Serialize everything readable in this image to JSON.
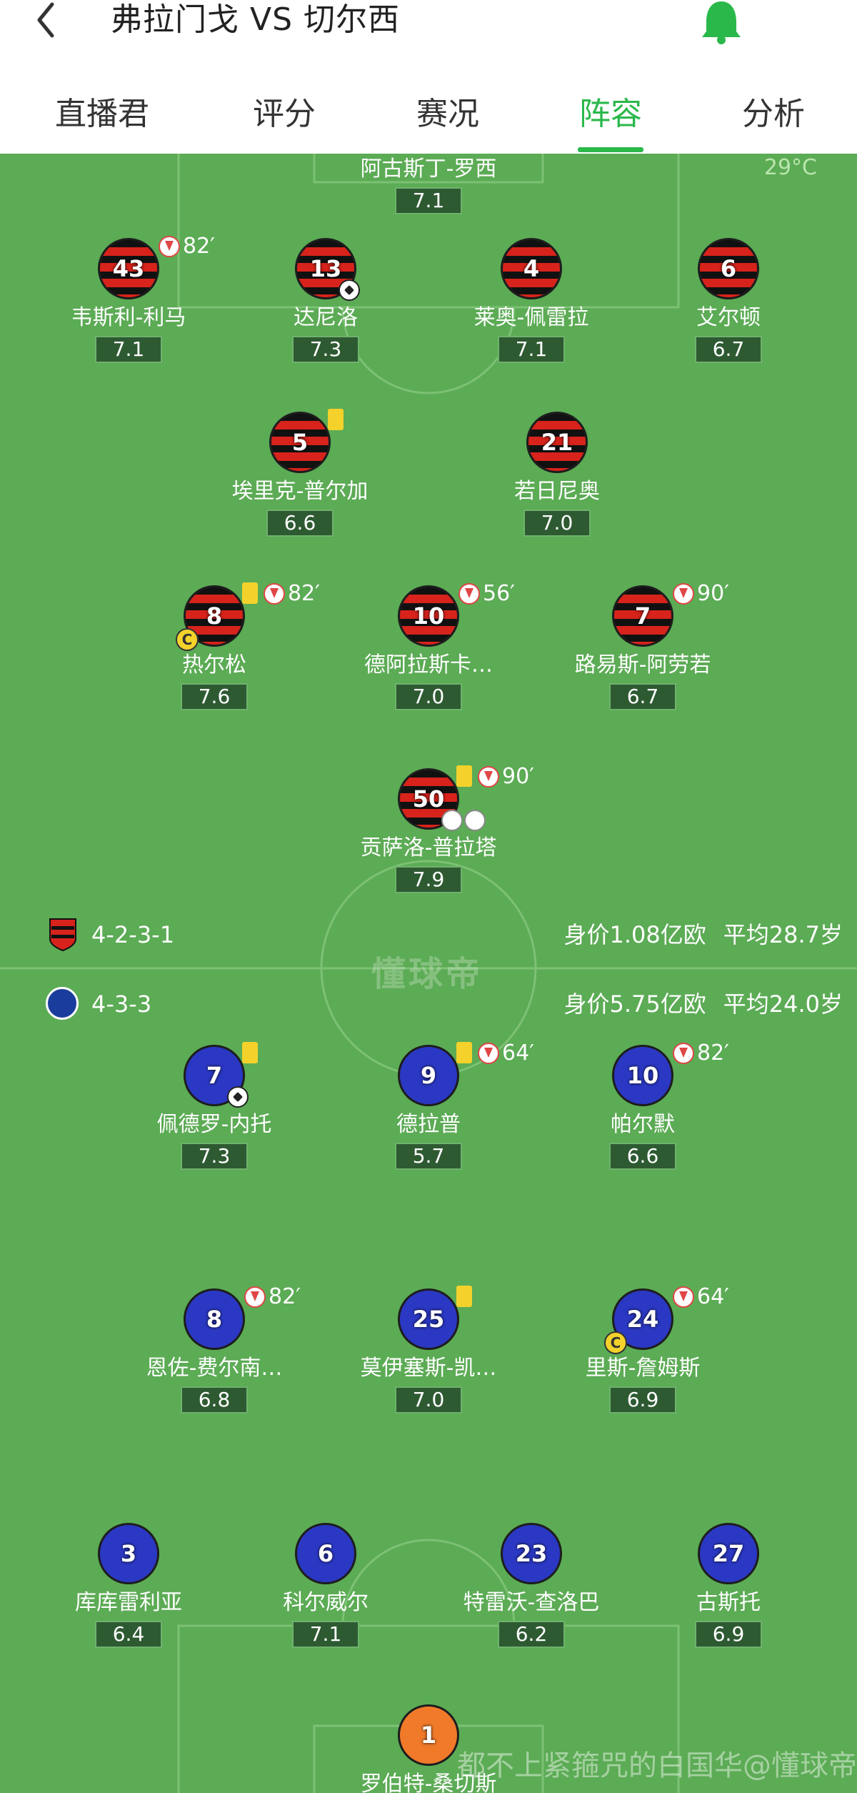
{
  "header": {
    "title": "弗拉门戈 VS 切尔西",
    "tabs": [
      {
        "label": "直播君"
      },
      {
        "label": "评分"
      },
      {
        "label": "赛况"
      },
      {
        "label": "阵容"
      },
      {
        "label": "分析"
      }
    ],
    "active_tab": "阵容",
    "accent_color": "#2bb84b"
  },
  "pitch": {
    "temperature": "29°C",
    "watermark": "懂球帝"
  },
  "home": {
    "formation": "4-2-3-1",
    "value": "身价1.08亿欧",
    "age": "平均28.7岁",
    "players": [
      {
        "num": "",
        "name": "阿古斯丁-罗西",
        "rating": "7.1"
      },
      {
        "num": "43",
        "name": "韦斯利-利马",
        "rating": "7.1",
        "sub": "82′"
      },
      {
        "num": "13",
        "name": "达尼洛",
        "rating": "7.3",
        "goal": true
      },
      {
        "num": "4",
        "name": "莱奥-佩雷拉",
        "rating": "7.1"
      },
      {
        "num": "6",
        "name": "艾尔顿",
        "rating": "6.7"
      },
      {
        "num": "5",
        "name": "埃里克-普尔加",
        "rating": "6.6",
        "yellow": true
      },
      {
        "num": "21",
        "name": "若日尼奥",
        "rating": "7.0"
      },
      {
        "num": "8",
        "name": "热尔松",
        "rating": "7.6",
        "sub": "82′",
        "yellow": true,
        "captain": true
      },
      {
        "num": "10",
        "name": "德阿拉斯卡…",
        "rating": "7.0",
        "sub": "56′"
      },
      {
        "num": "7",
        "name": "路易斯-阿劳若",
        "rating": "6.7",
        "sub": "90′"
      },
      {
        "num": "50",
        "name": "贡萨洛-普拉塔",
        "rating": "7.9",
        "sub": "90′",
        "yellow": true
      }
    ]
  },
  "away": {
    "formation": "4-3-3",
    "value": "身价5.75亿欧",
    "age": "平均24.0岁",
    "players": [
      {
        "num": "7",
        "name": "佩德罗-内托",
        "rating": "7.3",
        "yellow": true,
        "goal": true
      },
      {
        "num": "9",
        "name": "德拉普",
        "rating": "5.7",
        "yellow": true,
        "sub": "64′"
      },
      {
        "num": "10",
        "name": "帕尔默",
        "rating": "6.6",
        "sub": "82′"
      },
      {
        "num": "8",
        "name": "恩佐-费尔南…",
        "rating": "6.8",
        "sub": "82′"
      },
      {
        "num": "25",
        "name": "莫伊塞斯-凯…",
        "rating": "7.0",
        "yellow": true
      },
      {
        "num": "24",
        "name": "里斯-詹姆斯",
        "rating": "6.9",
        "sub": "64′",
        "captain": true
      },
      {
        "num": "3",
        "name": "库库雷利亚",
        "rating": "6.4"
      },
      {
        "num": "6",
        "name": "科尔威尔",
        "rating": "7.1"
      },
      {
        "num": "23",
        "name": "特雷沃-查洛巴",
        "rating": "6.2"
      },
      {
        "num": "27",
        "name": "古斯托",
        "rating": "6.9"
      },
      {
        "num": "1",
        "name": "罗伯特-桑切斯",
        "rating": ""
      }
    ]
  },
  "badges": {
    "captain": "C"
  },
  "footer_watermark": "都不上紧箍咒的白国华@懂球帝"
}
